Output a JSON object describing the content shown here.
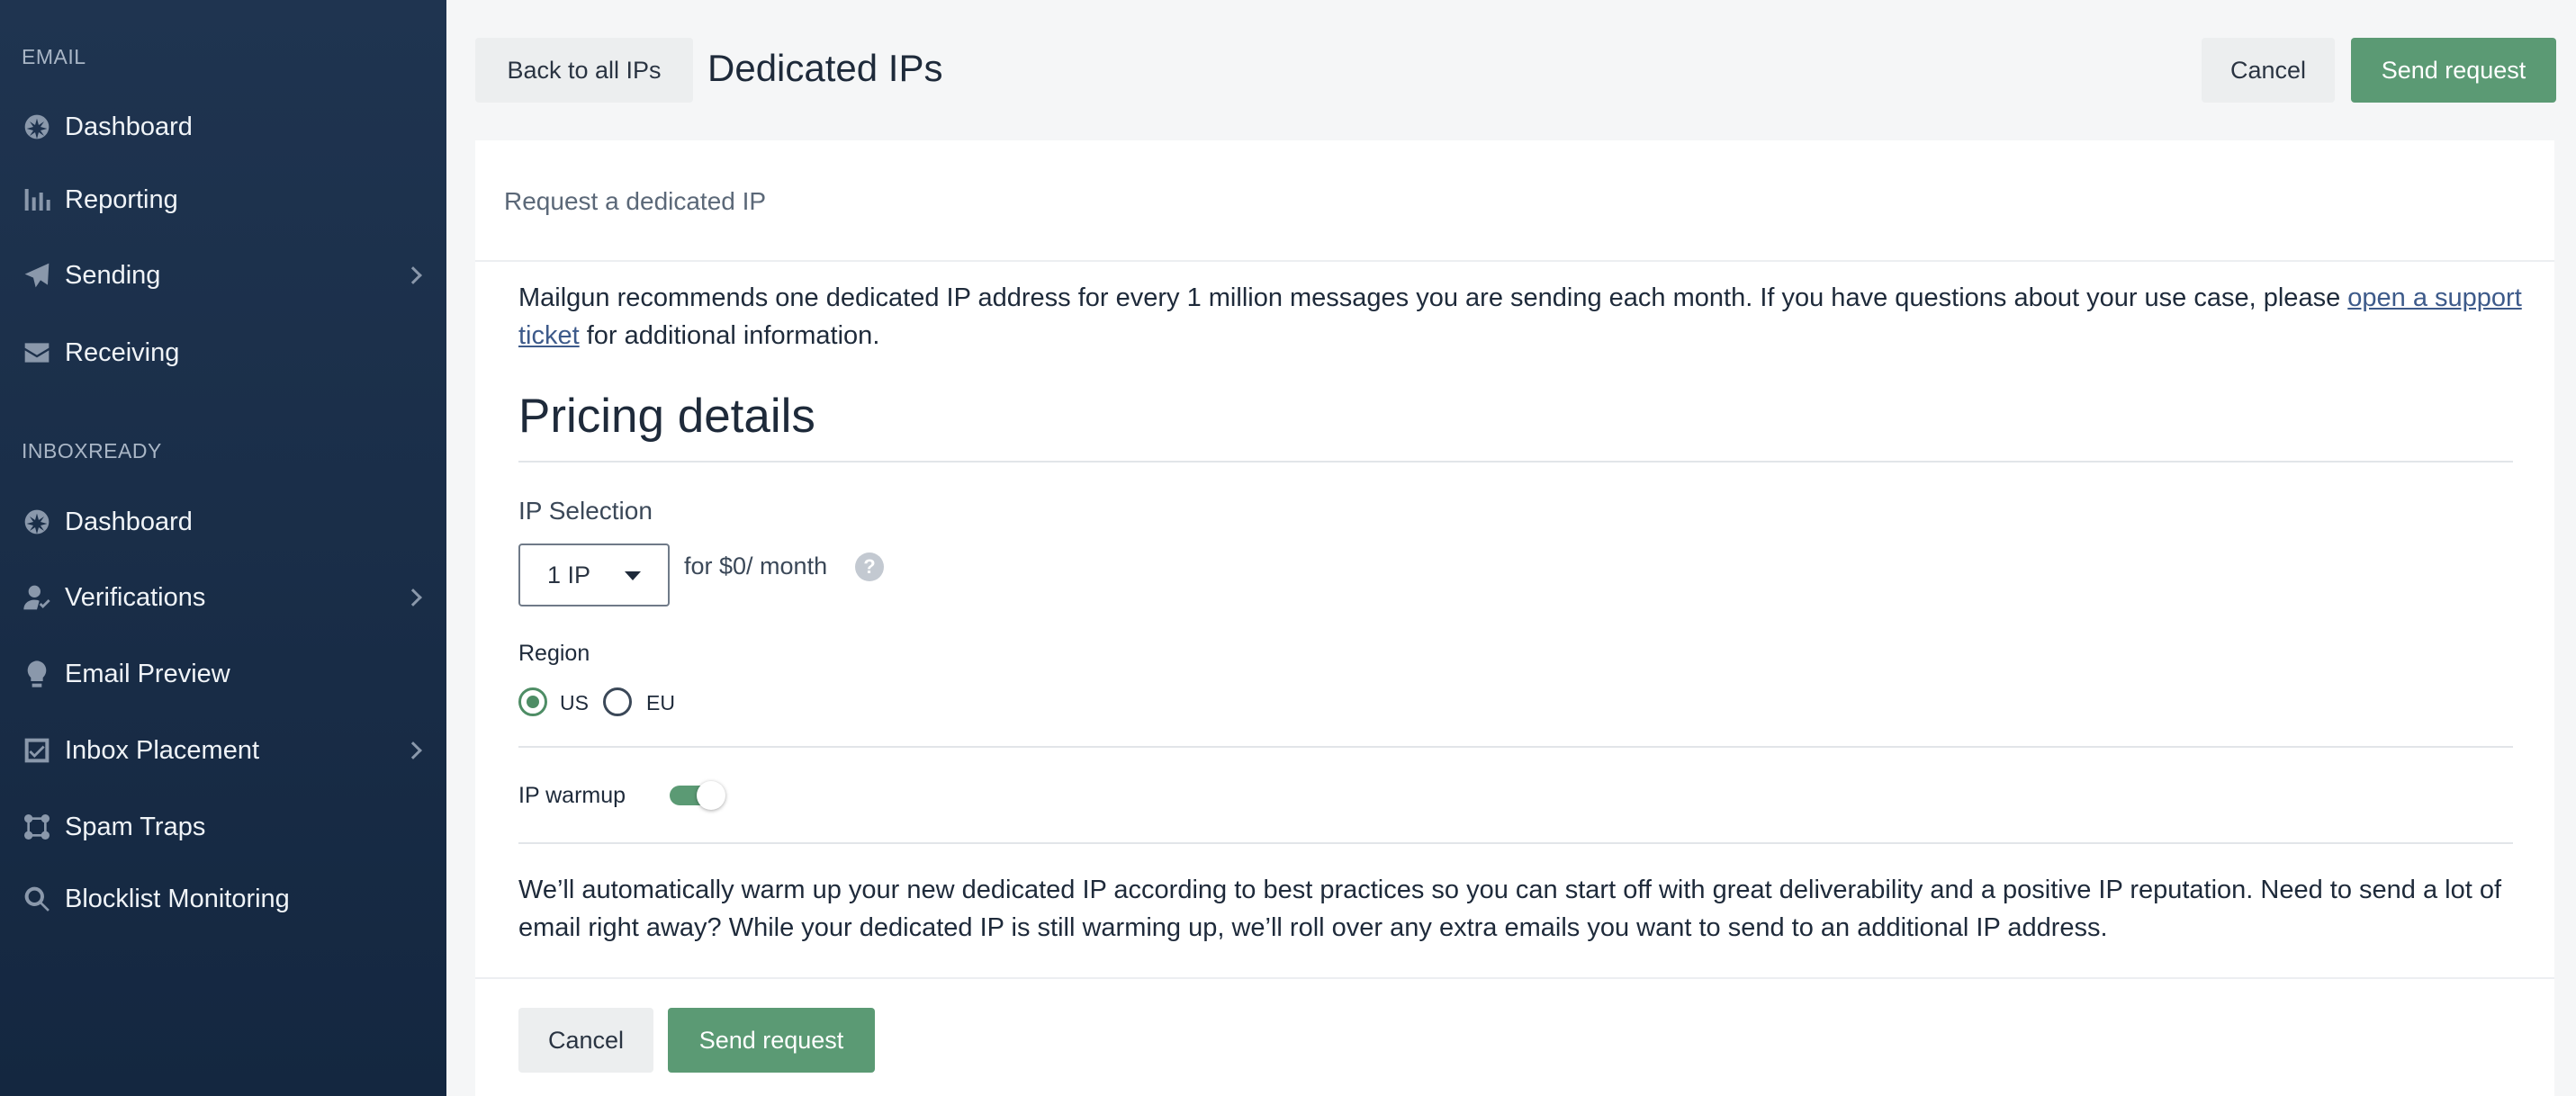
{
  "sidebar": {
    "sections": [
      {
        "title": "EMAIL",
        "items": [
          {
            "label": "Dashboard",
            "icon": "dashboard-icon",
            "has_submenu": false
          },
          {
            "label": "Reporting",
            "icon": "bar-chart-icon",
            "has_submenu": false
          },
          {
            "label": "Sending",
            "icon": "paper-plane-icon",
            "has_submenu": true
          },
          {
            "label": "Receiving",
            "icon": "envelope-icon",
            "has_submenu": false
          }
        ]
      },
      {
        "title": "INBOXREADY",
        "items": [
          {
            "label": "Dashboard",
            "icon": "dashboard-icon",
            "has_submenu": false
          },
          {
            "label": "Verifications",
            "icon": "user-check-icon",
            "has_submenu": true
          },
          {
            "label": "Email Preview",
            "icon": "lightbulb-icon",
            "has_submenu": false
          },
          {
            "label": "Inbox Placement",
            "icon": "checkbox-icon",
            "has_submenu": true
          },
          {
            "label": "Spam Traps",
            "icon": "network-icon",
            "has_submenu": false
          },
          {
            "label": "Blocklist Monitoring",
            "icon": "search-shield-icon",
            "has_submenu": false
          }
        ]
      }
    ]
  },
  "header": {
    "back_label": "Back to all IPs",
    "title": "Dedicated IPs",
    "cancel_label": "Cancel",
    "send_label": "Send request"
  },
  "card": {
    "title": "Request a dedicated IP",
    "intro_before": "Mailgun recommends one dedicated IP address for every 1 million messages you are sending each month. If you have questions about your use case, please ",
    "intro_link": "open a support ticket",
    "intro_after": " for additional information.",
    "pricing_heading": "Pricing details",
    "ip_selection_label": "IP Selection",
    "ip_selection_value": "1 IP",
    "price_text": "for $0/ month",
    "help_glyph": "?",
    "region_label": "Region",
    "regions": [
      {
        "label": "US",
        "checked": true
      },
      {
        "label": "EU",
        "checked": false
      }
    ],
    "warmup_label": "IP warmup",
    "warmup_enabled": true,
    "warmup_text": "We’ll automatically warm up your new dedicated IP according to best practices so you can start off with great deliverability and a positive IP reputation. Need to send a lot of email right away? While your dedicated IP is still warming up, we’ll roll over any extra emails you want to send to an additional IP address."
  },
  "footer": {
    "cancel_label": "Cancel",
    "send_label": "Send request"
  },
  "colors": {
    "sidebar_bg": "#1f3450",
    "accent_green": "#5b9a74",
    "page_bg": "#f5f6f7"
  }
}
